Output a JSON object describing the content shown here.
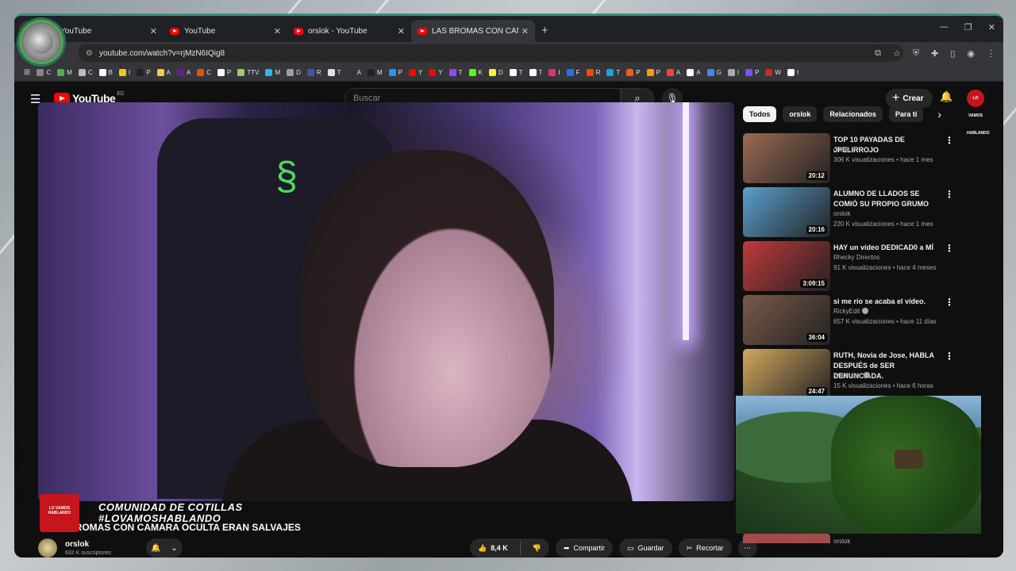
{
  "tabs": [
    {
      "title": "YouTube"
    },
    {
      "title": "YouTube"
    },
    {
      "title": "orslok - YouTube"
    },
    {
      "title": "LAS BROMAS CON CÁMARA OCULTA"
    }
  ],
  "address_bar": {
    "url": "youtube.com/watch?v=rjMzN6IQig8"
  },
  "bookmarks": [
    {
      "label": "C",
      "color": "#888888"
    },
    {
      "label": "M",
      "color": "#4caf50"
    },
    {
      "label": "C",
      "color": "#bbbbbb"
    },
    {
      "label": "B",
      "color": "#ffffff"
    },
    {
      "label": "I",
      "color": "#f5c518"
    },
    {
      "label": "P",
      "color": "#222222"
    },
    {
      "label": "A",
      "color": "#f7c948"
    },
    {
      "label": "A",
      "color": "#6a1b9a"
    },
    {
      "label": "C",
      "color": "#e65100"
    },
    {
      "label": "P",
      "color": "#ffffff"
    },
    {
      "label": "TTV",
      "color": "#9ccc65"
    },
    {
      "label": "M",
      "color": "#29b6f6"
    },
    {
      "label": "D",
      "color": "#9e9e9e"
    },
    {
      "label": "R",
      "color": "#3f51b5"
    },
    {
      "label": "T",
      "color": "#e0e0e0"
    },
    {
      "label": "A",
      "color": "#333333"
    },
    {
      "label": "M",
      "color": "#222222"
    },
    {
      "label": "P",
      "color": "#2196f3"
    },
    {
      "label": "Y",
      "color": "#ff0000"
    },
    {
      "label": "Y",
      "color": "#ff0000"
    },
    {
      "label": "T",
      "color": "#9146ff"
    },
    {
      "label": "K",
      "color": "#53fc18"
    },
    {
      "label": "D",
      "color": "#ffeb3b"
    },
    {
      "label": "T",
      "color": "#ffffff"
    },
    {
      "label": "T",
      "color": "#ffffff"
    },
    {
      "label": "I",
      "color": "#e1306c"
    },
    {
      "label": "F",
      "color": "#1877f2"
    },
    {
      "label": "R",
      "color": "#ff4500"
    },
    {
      "label": "T",
      "color": "#229ed9"
    },
    {
      "label": "P",
      "color": "#ff5722"
    },
    {
      "label": "P",
      "color": "#ff9800"
    },
    {
      "label": "A",
      "color": "#f44336"
    },
    {
      "label": "A",
      "color": "#ffffff"
    },
    {
      "label": "G",
      "color": "#4285f4"
    },
    {
      "label": "I",
      "color": "#aaaaaa"
    },
    {
      "label": "P",
      "color": "#7c4dff"
    },
    {
      "label": "W",
      "color": "#c62828"
    },
    {
      "label": "I",
      "color": "#ffffff"
    }
  ],
  "header": {
    "logo": "YouTube",
    "region": "ES",
    "search_placeholder": "Buscar",
    "create_label": "Crear",
    "account_label": "LO VAMOS HABLANDO"
  },
  "video": {
    "title": "BROMAS CON CÁMARA OCULTA ERAN SALVAJES",
    "overlay_line1": "COMUNIDAD DE COTILLAS",
    "overlay_line2": "#LOVAMOSHABLANDO",
    "overlay_logo": "LO VAMOS HABLANDO"
  },
  "channel": {
    "name": "orslok",
    "subscribers": "632 K suscriptores"
  },
  "actions": {
    "likes": "8,4 K",
    "share": "Compartir",
    "save": "Guardar",
    "clip": "Recortar"
  },
  "chips": [
    "Todos",
    "orslok",
    "Relacionados",
    "Para ti"
  ],
  "recommendations": [
    {
      "title": "TOP 10 PAYADAS DE JPELIRROJO",
      "channel": "orslok",
      "verified": false,
      "meta": "306 K visualizaciones • hace 1 mes",
      "duration": "20:12",
      "thumb_color": "#9b6b52"
    },
    {
      "title": "ALUMNO DE LLADOS SE COMIÓ SU PROPIO GRUMO",
      "channel": "orslok",
      "verified": false,
      "meta": "220 K visualizaciones • hace 1 mes",
      "duration": "20:16",
      "thumb_color": "#5aa0cf"
    },
    {
      "title": "HAY un vídeo DEDICAD0 a MÍ",
      "channel": "Rhecky Directos",
      "verified": false,
      "meta": "91 K visualizaciones • hace 4 meses",
      "duration": "3:09:15",
      "thumb_color": "#c0393b"
    },
    {
      "title": "si me río se acaba el vídeo.",
      "channel": "RickyEdit",
      "verified": true,
      "meta": "657 K visualizaciones • hace 11 días",
      "duration": "36:04",
      "thumb_color": "#7b5a4a"
    },
    {
      "title": "RUTH, Novia de Jose, HABLA DESPUÉS de SER DENUNCIADA.",
      "channel": "WildHater",
      "verified": true,
      "meta": "15 K visualizaciones • hace 6 horas",
      "duration": "24:47",
      "thumb_color": "#d3a85e"
    }
  ],
  "last_channel": "orslok"
}
